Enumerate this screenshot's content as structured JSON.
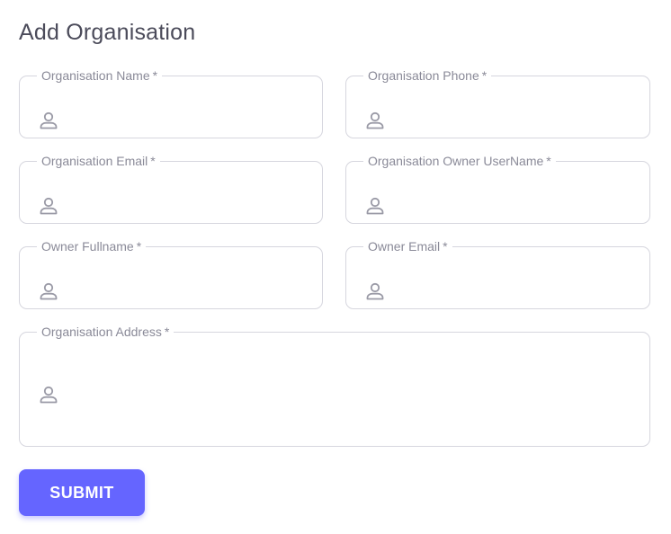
{
  "page": {
    "title": "Add Organisation"
  },
  "form": {
    "required_marker": "*",
    "fields": [
      {
        "label": "Organisation Name",
        "value": "",
        "icon": "person-icon"
      },
      {
        "label": "Organisation Phone",
        "value": "",
        "icon": "person-icon"
      },
      {
        "label": "Organisation Email",
        "value": "",
        "icon": "person-icon"
      },
      {
        "label": "Organisation Owner UserName",
        "value": "",
        "icon": "person-icon"
      },
      {
        "label": "Owner Fullname",
        "value": "",
        "icon": "person-icon"
      },
      {
        "label": "Owner Email",
        "value": "",
        "icon": "person-icon"
      },
      {
        "label": "Organisation Address",
        "value": "",
        "icon": "person-icon"
      }
    ],
    "submit_label": "SUBMIT"
  },
  "colors": {
    "accent": "#6565ff",
    "border": "#d6d6de",
    "label": "#8a8a98",
    "icon": "#9a9aa6",
    "title": "#4b4b5a"
  }
}
